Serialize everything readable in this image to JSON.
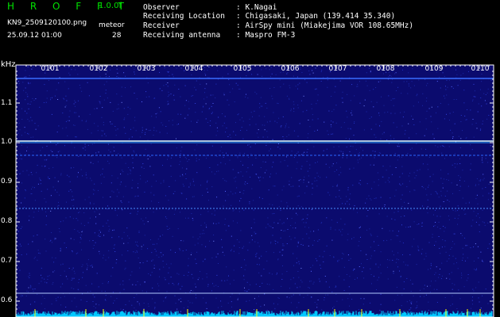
{
  "header": {
    "app_title": "H R O F F T",
    "version": "1.0.0f",
    "file_name": "KN9_2509120100.png",
    "meteor_label": "meteor",
    "datetime": "25.09.12 01:00",
    "meteor_count": "28",
    "info": [
      {
        "label": "Observer",
        "value": ": K.Nagai"
      },
      {
        "label": "Receiving Location",
        "value": ": Chigasaki, Japan (139.414 35.340)"
      },
      {
        "label": "Receiver",
        "value": ": AirSpy mini (Miakejima VOR 108.65MHz)"
      },
      {
        "label": "Receiving antenna",
        "value": ": Maspro FM-3"
      }
    ]
  },
  "spectrogram": {
    "y_unit": "kHz",
    "y_ticks": [
      "1.1",
      "1.0",
      "0.9",
      "0.8",
      "0.7",
      "0.6"
    ],
    "time_labels": [
      "0101",
      "0102",
      "0103",
      "0104",
      "0105",
      "0106",
      "0107",
      "0108",
      "0109",
      "0110"
    ],
    "colors": {
      "background": "#0b0b6e",
      "axis": "#ffffff",
      "title": "#00e000",
      "trace": "#00c8ff",
      "marker": "#ffff00"
    }
  }
}
